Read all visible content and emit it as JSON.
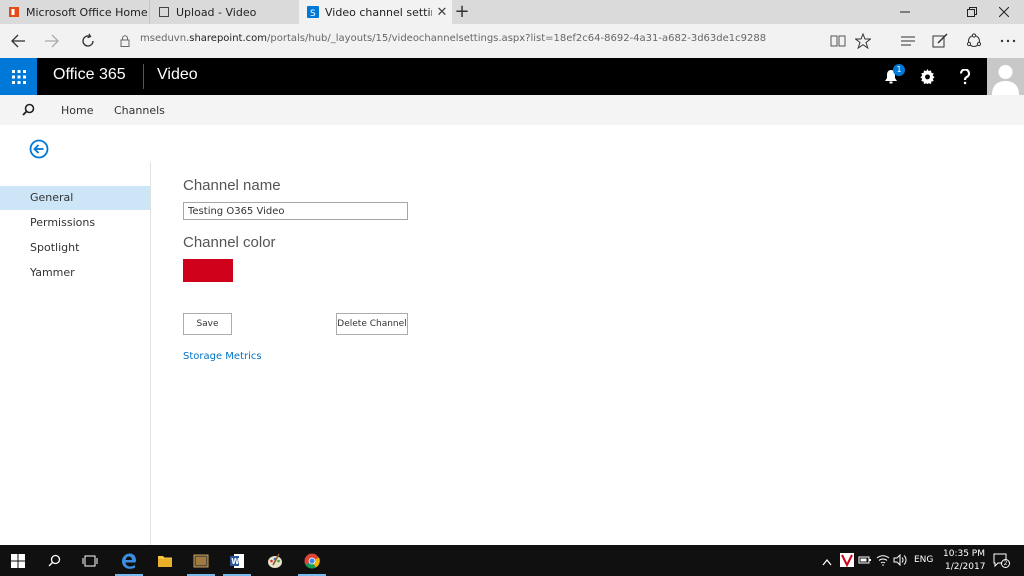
{
  "browser": {
    "tabs": [
      {
        "label": "Microsoft Office Home",
        "favicon": "office-icon",
        "active": false
      },
      {
        "label": "Upload - Video",
        "favicon": "page-icon",
        "active": false
      },
      {
        "label": "Video channel settings",
        "favicon": "sharepoint-icon",
        "active": true
      }
    ],
    "new_tab": "+",
    "url_prefix": "mseduvn.",
    "url_domain": "sharepoint.com",
    "url_path": "/portals/hub/_layouts/15/videochannelsettings.aspx?list=18ef2c64-8692-4a31-a682-3d63de1c9288"
  },
  "suite": {
    "brand": "Office 365",
    "app": "Video",
    "notification_count": "1"
  },
  "subnav": {
    "home": "Home",
    "channels": "Channels"
  },
  "leftnav": {
    "items": [
      {
        "label": "General",
        "selected": true
      },
      {
        "label": "Permissions",
        "selected": false
      },
      {
        "label": "Spotlight",
        "selected": false
      },
      {
        "label": "Yammer",
        "selected": false
      }
    ]
  },
  "main": {
    "channel_name_heading": "Channel name",
    "channel_name_value": "Testing O365 Video",
    "channel_color_heading": "Channel color",
    "channel_color": "#d0021b",
    "save_label": "Save",
    "delete_label": "Delete Channel",
    "storage_link": "Storage Metrics"
  },
  "taskbar": {
    "language": "ENG",
    "time": "10:35 PM",
    "date": "1/2/2017",
    "notification_badge": "2"
  },
  "colors": {
    "accent": "#0078d7",
    "suitebar": "#000000",
    "selected_nav": "#cde6f7",
    "link": "#0072c6"
  }
}
